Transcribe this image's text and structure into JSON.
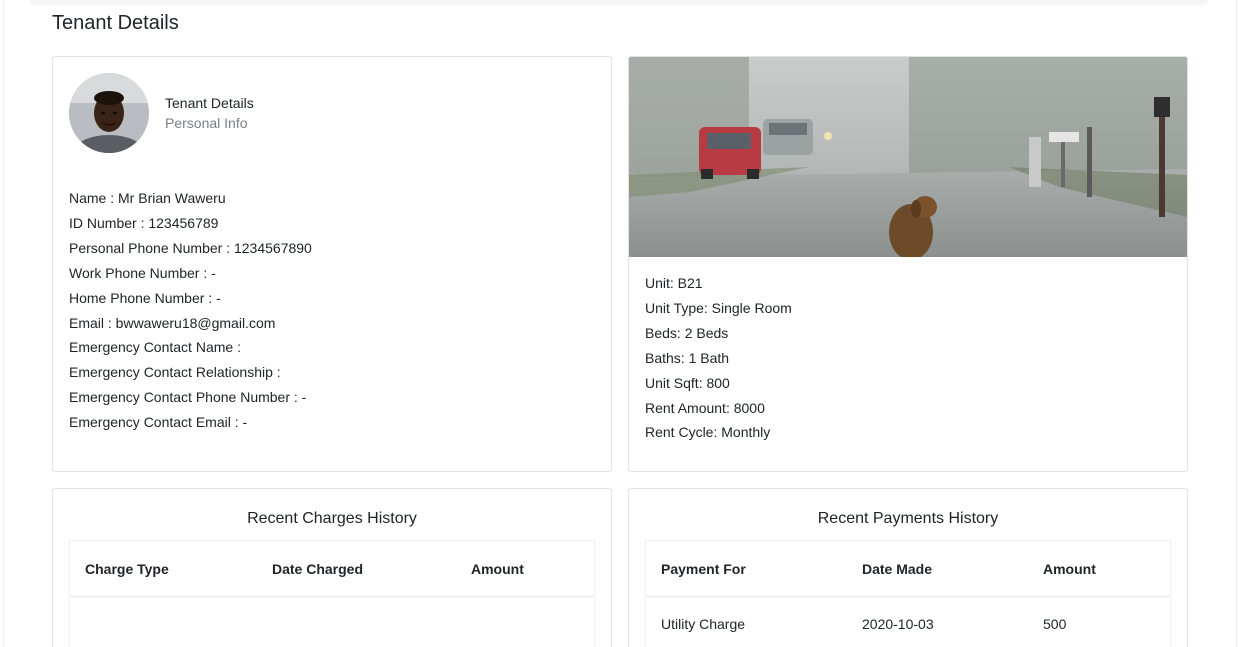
{
  "page": {
    "title": "Tenant Details"
  },
  "tenant_card": {
    "header_title": "Tenant Details",
    "header_subtitle": "Personal Info",
    "fields": [
      "Name : Mr Brian Waweru",
      "ID Number : 123456789",
      "Personal Phone Number : 1234567890",
      "Work Phone Number : -",
      "Home Phone Number : -",
      "Email : bwwaweru18@gmail.com",
      "Emergency Contact Name :",
      "Emergency Contact Relationship :",
      "Emergency Contact Phone Number : -",
      "Emergency Contact Email : -"
    ]
  },
  "unit_card": {
    "fields": [
      "Unit: B21",
      "Unit Type: Single Room",
      "Beds: 2 Beds",
      "Baths: 1 Bath",
      "Unit Sqft: 800",
      "Rent Amount: 8000",
      "Rent Cycle: Monthly"
    ]
  },
  "charges": {
    "title": "Recent Charges History",
    "columns": [
      "Charge Type",
      "Date Charged",
      "Amount"
    ],
    "rows": []
  },
  "payments": {
    "title": "Recent Payments History",
    "columns": [
      "Payment For",
      "Date Made",
      "Amount"
    ],
    "rows": [
      [
        "Utility Charge",
        "2020-10-03",
        "500"
      ]
    ]
  },
  "colors": {
    "border": "#dfe2e6",
    "text": "#212529",
    "muted": "#7a7f86"
  },
  "icons": {
    "avatar": "tenant-avatar-photo",
    "unit_image": "unit-street-photo"
  }
}
